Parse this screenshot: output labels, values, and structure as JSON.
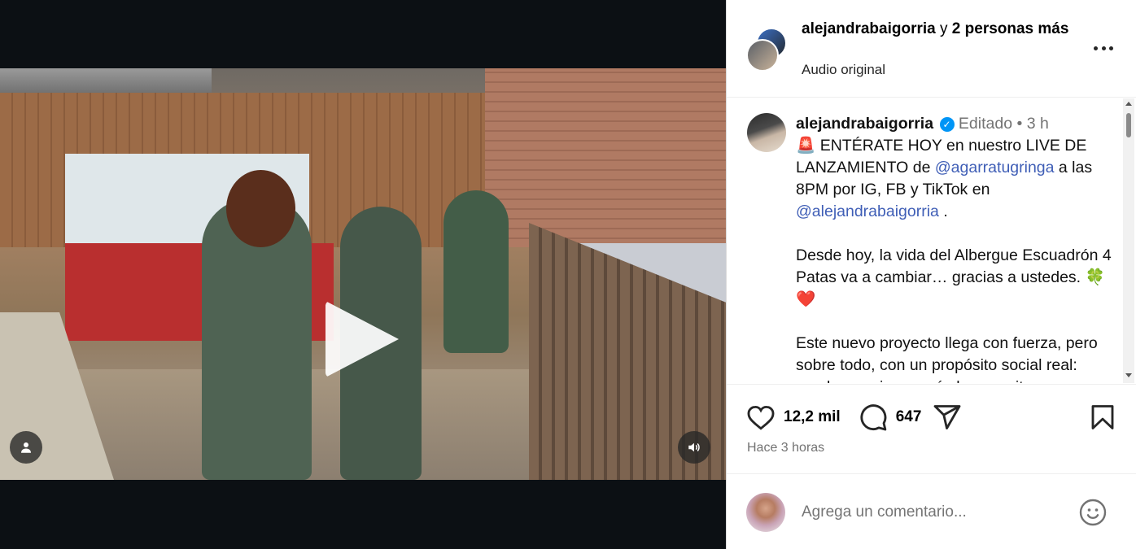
{
  "header": {
    "username": "alejandrabaigorria",
    "connector": " y ",
    "others": "2 personas más",
    "audio": "Audio original"
  },
  "caption": {
    "username": "alejandrabaigorria",
    "edited": "Editado",
    "dot": "•",
    "time": "3 h",
    "line1_emoji": "🚨",
    "line1_text": " ENTÉRATE HOY en nuestro LIVE DE LANZAMIENTO de ",
    "mention1": "@agarratugringa",
    "line1_cont": " a las 8PM por IG, FB y TikTok en ",
    "mention2": "@alejandrabaigorria",
    "line1_end": " .",
    "para2": "Desde hoy, la vida del Albergue Escuadrón 4 Patas va a cambiar… gracias a ustedes. ",
    "para2_emoji": "🍀❤️",
    "para3": "Este nuevo proyecto llega con fuerza, pero sobre todo, con un propósito social real: ayudar a quienes más lo necesitan."
  },
  "actions": {
    "likes": "12,2 mil",
    "comments": "647",
    "time_ago": "Hace 3 horas"
  },
  "comment_box": {
    "placeholder": "Agrega un comentario..."
  },
  "icons": {
    "like": "heart-icon",
    "comment": "comment-icon",
    "share": "share-icon",
    "save": "bookmark-icon",
    "emoji": "emoji-icon",
    "more": "more-icon",
    "sound": "speaker-icon",
    "tags": "user-tag-icon",
    "play": "play-icon"
  },
  "colors": {
    "link": "#3f5eb6",
    "verified": "#0095f6",
    "muted": "#737373"
  }
}
